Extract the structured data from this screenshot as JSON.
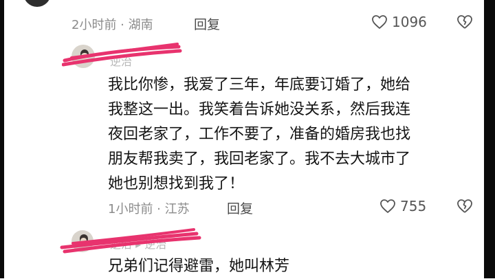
{
  "comment_prev": {
    "meta": "2小时前 · 湖南",
    "reply_label": "回复",
    "likes": "1096"
  },
  "comment_main": {
    "username": "逆治",
    "text": "我比你惨，我爱了三年，年底要订婚了，她给\n我整这一出。我笑着告诉她没关系，然后我连\n夜回老家了，工作不要了，准备的婚房我也找\n朋友帮我卖了，我回老家了。我不去大城市了\n她也别想找到我了！",
    "meta": "1小时前 · 江苏",
    "reply_label": "回复",
    "likes": "755"
  },
  "comment_reply": {
    "username": "逆治 ▸ 逆治",
    "text": "兄弟们记得避雷，她叫林芳"
  },
  "colors": {
    "scribble": "#e8336e",
    "meta": "#8b8b8b"
  },
  "icons": [
    "heart-outline-icon",
    "broken-heart-icon"
  ]
}
